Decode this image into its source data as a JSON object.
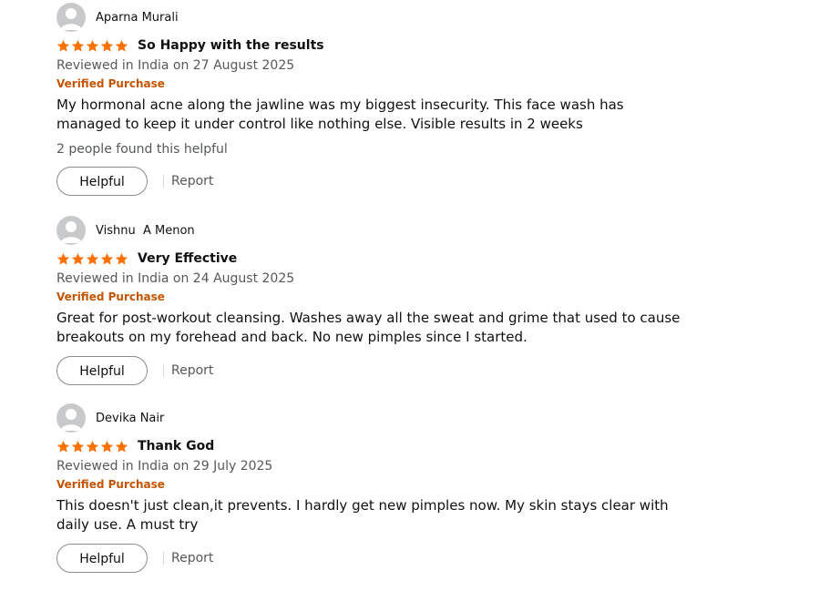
{
  "colors": {
    "star": "#ff6e00",
    "verified": "#c45500",
    "muted_text": "#565959",
    "body_text": "#0f1111"
  },
  "icons": {
    "avatar": "default-user-avatar-icon",
    "star": "star-icon"
  },
  "reviews": [
    {
      "reviewer_name": "Aparna Murali",
      "rating": 5,
      "title": "So Happy with the results",
      "date_text": "Reviewed in India on 27 August 2025",
      "verified_label": "Verified Purchase",
      "body": "My hormonal acne along the jawline was my biggest insecurity. This face wash has managed to keep it under control like nothing else. Visible results in 2 weeks",
      "helpful_count_text": "2 people found this helpful",
      "helpful_label": "Helpful",
      "report_label": "Report"
    },
    {
      "reviewer_name": "Vishnu  A Menon",
      "rating": 5,
      "title": "Very Effective",
      "date_text": "Reviewed in India on 24 August 2025",
      "verified_label": "Verified Purchase",
      "body": "Great for post-workout cleansing. Washes away all the sweat and grime that used to cause breakouts on my forehead and back. No new pimples since I started.",
      "helpful_label": "Helpful",
      "report_label": "Report"
    },
    {
      "reviewer_name": "Devika Nair",
      "rating": 5,
      "title": "Thank God",
      "date_text": "Reviewed in India on 29 July 2025",
      "verified_label": "Verified Purchase",
      "body": "This doesn't just clean,it prevents. I hardly get new pimples now. My skin stays clear with daily use. A must try",
      "helpful_label": "Helpful",
      "report_label": "Report"
    }
  ]
}
